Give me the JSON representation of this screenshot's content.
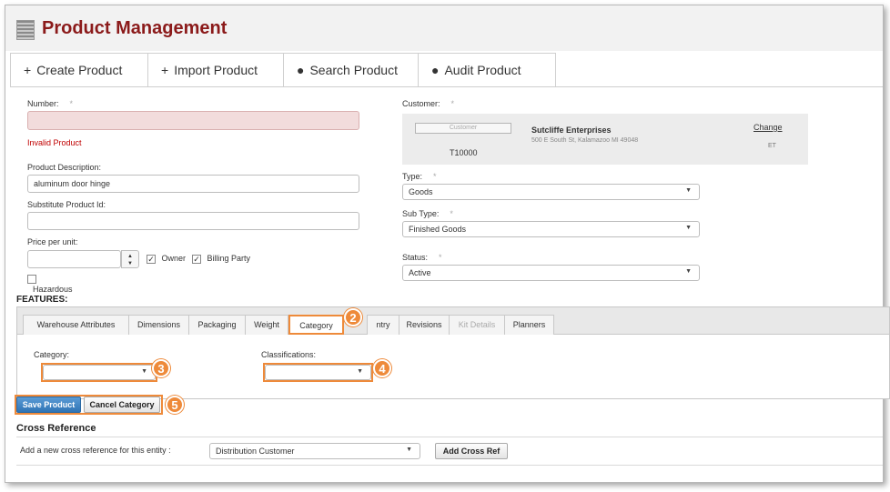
{
  "app": {
    "title": "Product Management"
  },
  "tabs": [
    {
      "icon": "plus-icon",
      "glyph": "+",
      "label": "Create Product"
    },
    {
      "icon": "plus-icon",
      "glyph": "+",
      "label": "Import Product"
    },
    {
      "icon": "search-circle-icon",
      "glyph": "●",
      "label": "Search Product"
    },
    {
      "icon": "audit-circle-icon",
      "glyph": "●",
      "label": "Audit Product"
    }
  ],
  "form": {
    "number": {
      "label": "Number:",
      "required": "*",
      "value": "",
      "error": "Invalid Product"
    },
    "description": {
      "label": "Product Description:",
      "value": "aluminum door hinge"
    },
    "substitute": {
      "label": "Substitute Product Id:",
      "value": ""
    },
    "price": {
      "label": "Price per unit:",
      "value": ""
    },
    "owner": {
      "label": "Owner",
      "checked": true
    },
    "billing_party": {
      "label": "Billing Party",
      "checked": true
    },
    "hazardous": {
      "label": "Hazardous",
      "checked": false
    },
    "customer": {
      "label": "Customer:",
      "required": "*",
      "button_label": "Customer",
      "code": "T10000",
      "name": "Sutcliffe Enterprises",
      "address": "500 E South St, Kalamazoo MI 49048",
      "change_label": "Change",
      "tz": "ET"
    },
    "type": {
      "label": "Type:",
      "required": "*",
      "value": "Goods"
    },
    "sub_type": {
      "label": "Sub Type:",
      "required": "*",
      "value": "Finished Goods"
    },
    "status": {
      "label": "Status:",
      "required": "*",
      "value": "Active"
    }
  },
  "features": {
    "heading": "FEATURES:",
    "tabs": [
      {
        "label": "Warehouse Attributes"
      },
      {
        "label": "Dimensions"
      },
      {
        "label": "Packaging"
      },
      {
        "label": "Weight"
      },
      {
        "label": "Category"
      },
      {
        "label": "ntry"
      },
      {
        "label": "Revisions"
      },
      {
        "label": "Kit Details"
      },
      {
        "label": "Planners"
      }
    ],
    "category": {
      "label": "Category:",
      "value": ""
    },
    "classifications": {
      "label": "Classifications:",
      "value": ""
    }
  },
  "buttons": {
    "save": "Save Product",
    "cancel": "Cancel Category"
  },
  "callouts": {
    "c2": "2",
    "c3": "3",
    "c4": "4",
    "c5": "5"
  },
  "cross_reference": {
    "heading": "Cross Reference",
    "prompt": "Add a new cross reference for this entity :",
    "select_value": "Distribution Customer",
    "add_button": "Add Cross Ref"
  },
  "colors": {
    "title": "#8b1a1a",
    "accent": "#ee8a3a",
    "primary_button": "#2f74b5",
    "error": "#c00000"
  }
}
